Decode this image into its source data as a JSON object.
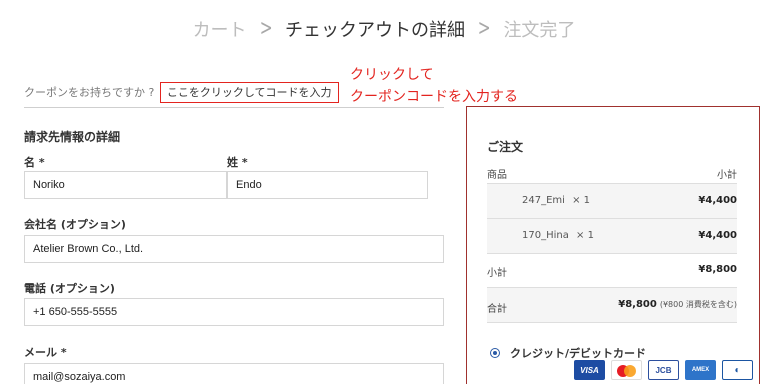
{
  "breadcrumb": {
    "step1": "カート",
    "step2": "チェックアウトの詳細",
    "step3": "注文完了"
  },
  "coupon": {
    "prompt": "クーポンをお持ちですか ?",
    "link": "ここをクリックしてコードを入力"
  },
  "annotation": {
    "line1": "クリックして",
    "line2": "クーポンコードを入力する"
  },
  "billing": {
    "title": "請求先情報の詳細",
    "first_name_label": "名 *",
    "first_name_value": "Noriko",
    "last_name_label": "姓 *",
    "last_name_value": "Endo",
    "company_label": "会社名 (オプション)",
    "company_value": "Atelier Brown Co., Ltd.",
    "phone_label": "電話 (オプション)",
    "phone_value": "+1 650-555-5555",
    "email_label": "メール *",
    "email_value": "mail@sozaiya.com"
  },
  "order": {
    "title": "ご注文",
    "col_product": "商品",
    "col_subtotal": "小計",
    "items": [
      {
        "name": "247_Emi",
        "qty": "× 1",
        "amount": "¥4,400"
      },
      {
        "name": "170_Hina",
        "qty": "× 1",
        "amount": "¥4,400"
      }
    ],
    "subtotal_label": "小計",
    "subtotal_value": "¥8,800",
    "total_label": "合計",
    "total_value": "¥8,800",
    "total_tax_note": "(¥800 消費税を含む)"
  },
  "payment": {
    "method_label": "クレジット/デビットカード",
    "cards": [
      "VISA",
      "Mastercard",
      "JCB",
      "AMERICAN EXPRESS",
      "Diners Club"
    ]
  }
}
